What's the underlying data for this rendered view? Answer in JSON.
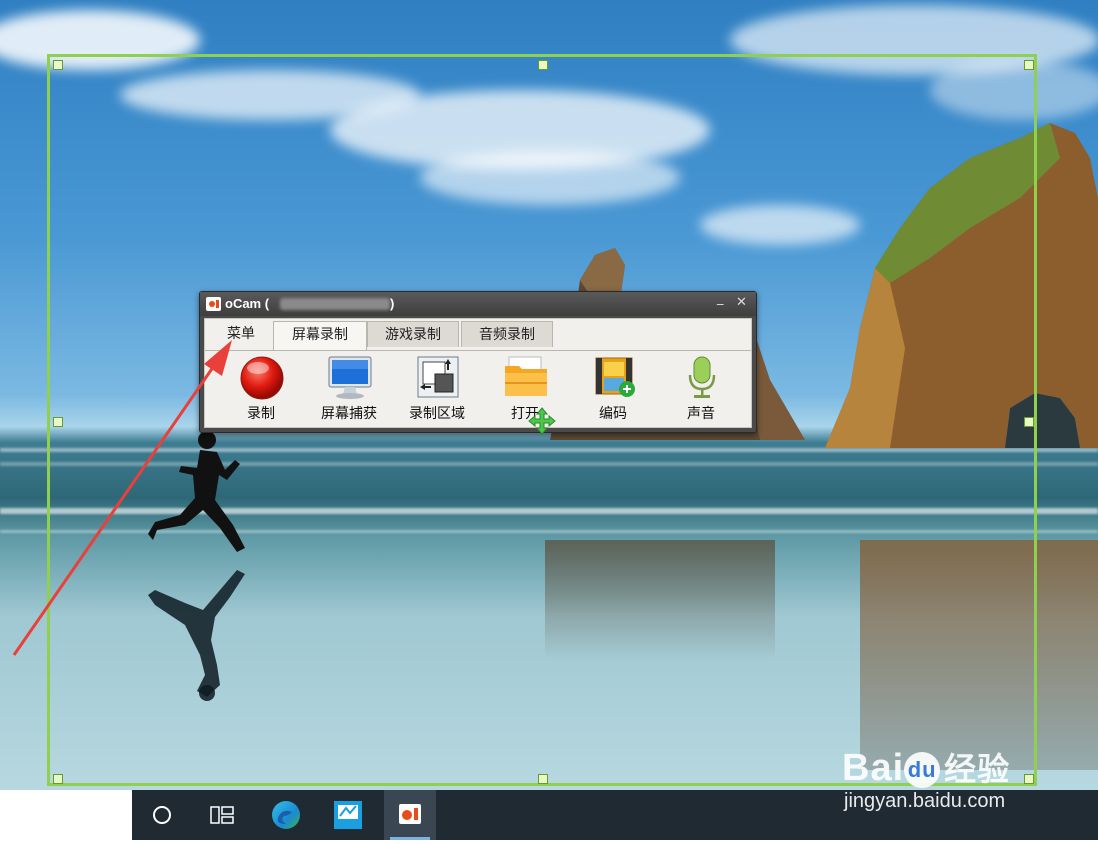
{
  "window": {
    "title": "oCam (",
    "title_close_paren": ")",
    "minimize_glyph": "_",
    "close_glyph": "✕"
  },
  "tabs": [
    {
      "label": "菜单",
      "active": false
    },
    {
      "label": "屏幕录制",
      "active": true
    },
    {
      "label": "游戏录制",
      "active": false
    },
    {
      "label": "音频录制",
      "active": false
    }
  ],
  "tools": [
    {
      "label": "录制",
      "icon": "record-icon"
    },
    {
      "label": "屏幕捕获",
      "icon": "monitor-icon"
    },
    {
      "label": "录制区域",
      "icon": "region-icon"
    },
    {
      "label": "打开",
      "icon": "folder-icon"
    },
    {
      "label": "编码",
      "icon": "codec-film-icon"
    },
    {
      "label": "声音",
      "icon": "microphone-icon"
    }
  ],
  "taskbar": {
    "items": [
      "search-circle-icon",
      "task-view-icon",
      "edge-icon",
      "app-icon",
      "ocam-icon"
    ]
  },
  "watermark": {
    "brand": "Bai",
    "brand2": "du",
    "cn": "经验",
    "url": "jingyan.baidu.com"
  },
  "colors": {
    "selection_border": "#8fd14f",
    "arrow": "#e8403a",
    "titlebar": "#4a4a4a"
  }
}
